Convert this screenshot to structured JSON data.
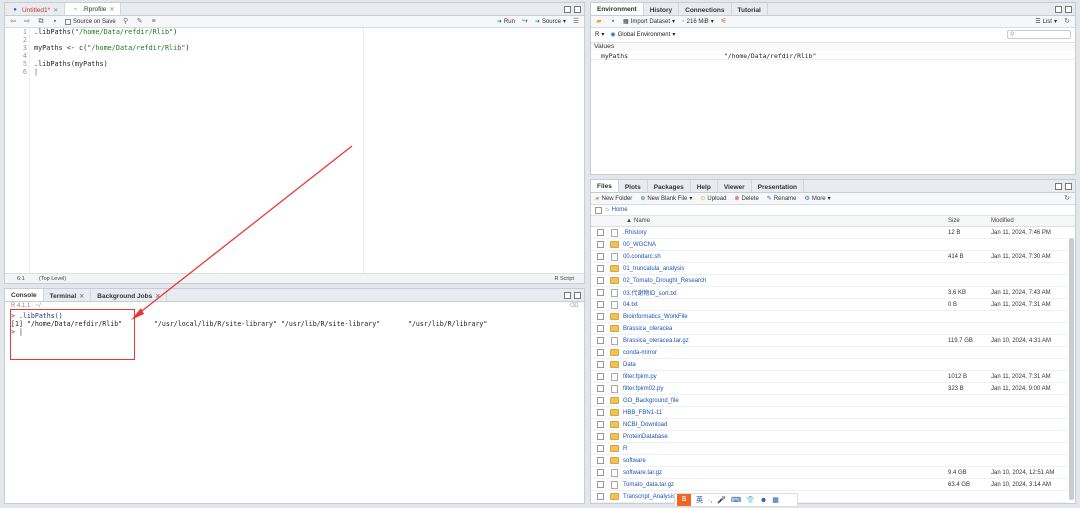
{
  "source_pane": {
    "tabs": [
      {
        "label": "Untitled1*"
      },
      {
        "label": ".Rprofile"
      }
    ],
    "toolbar": {
      "source_on_save": "Source on Save",
      "run": "Run",
      "source": "Source"
    },
    "lines": [
      {
        "n": "1",
        "prefix": ".libPaths(",
        "str": "\"/home/Data/refdir/Rlib\"",
        "suffix": ")"
      },
      {
        "n": "2",
        "prefix": "",
        "str": "",
        "suffix": ""
      },
      {
        "n": "3",
        "prefix": "myPaths <- c(",
        "str": "\"/home/Data/refdir/Rlib\"",
        "suffix": ")"
      },
      {
        "n": "4",
        "prefix": "",
        "str": "",
        "suffix": ""
      },
      {
        "n": "5",
        "prefix": ".libPaths(myPaths)",
        "str": "",
        "suffix": ""
      },
      {
        "n": "6",
        "prefix": "",
        "str": "",
        "suffix": ""
      }
    ],
    "status": {
      "position": "6:1",
      "scope": "(Top Level)",
      "type": "R Script"
    }
  },
  "console_pane": {
    "tabs": [
      {
        "label": "Console"
      },
      {
        "label": "Terminal"
      },
      {
        "label": "Background Jobs"
      }
    ],
    "header": "R 4.1.1 · ~/",
    "command": ".libPaths()",
    "output": "[1] \"/home/Data/refdir/Rlib\"        \"/usr/local/lib/R/site-library\" \"/usr/lib/R/site-library\"       \"/usr/lib/R/library\"",
    "prompt": ">"
  },
  "env_pane": {
    "tabs": [
      {
        "label": "Environment"
      },
      {
        "label": "History"
      },
      {
        "label": "Connections"
      },
      {
        "label": "Tutorial"
      }
    ],
    "import_dataset": "Import Dataset",
    "memory": "216 MiB",
    "list_view": "List",
    "language": "R",
    "scope": "Global Environment",
    "section": "Values",
    "values": [
      {
        "name": "myPaths",
        "value": "\"/home/Data/refdir/Rlib\""
      }
    ]
  },
  "files_pane": {
    "tabs": [
      {
        "label": "Files"
      },
      {
        "label": "Plots"
      },
      {
        "label": "Packages"
      },
      {
        "label": "Help"
      },
      {
        "label": "Viewer"
      },
      {
        "label": "Presentation"
      }
    ],
    "toolbar": {
      "new_folder": "New Folder",
      "new_blank_file": "New Blank File",
      "upload": "Upload",
      "delete": "Delete",
      "rename": "Rename",
      "more": "More"
    },
    "breadcrumb": "Home",
    "columns": {
      "name": "Name",
      "size": "Size",
      "modified": "Modified"
    },
    "files": [
      {
        "name": ".Rhistory",
        "size": "12 B",
        "modified": "Jan 11, 2024, 7:46 PM",
        "kind": "file"
      },
      {
        "name": "00_WGCNA",
        "size": "",
        "modified": "",
        "kind": "folder"
      },
      {
        "name": "00.condarc.sh",
        "size": "414 B",
        "modified": "Jan 11, 2024, 7:30 AM",
        "kind": "file"
      },
      {
        "name": "01_truncatula_analysis",
        "size": "",
        "modified": "",
        "kind": "folder"
      },
      {
        "name": "02_Tomato_Drought_Research",
        "size": "",
        "modified": "",
        "kind": "folder"
      },
      {
        "name": "03.代谢物ID_sort.txt",
        "size": "3.6 KB",
        "modified": "Jan 11, 2024, 7:43 AM",
        "kind": "file"
      },
      {
        "name": "04.txt",
        "size": "0 B",
        "modified": "Jan 11, 2024, 7:31 AM",
        "kind": "file"
      },
      {
        "name": "Bioinformatics_WorkFile",
        "size": "",
        "modified": "",
        "kind": "folder"
      },
      {
        "name": "Brassica_oleracea",
        "size": "",
        "modified": "",
        "kind": "folder"
      },
      {
        "name": "Brassica_oleracea.tar.gz",
        "size": "119.7 GB",
        "modified": "Jan 10, 2024, 4:31 AM",
        "kind": "file"
      },
      {
        "name": "conda-mirror",
        "size": "",
        "modified": "",
        "kind": "folder"
      },
      {
        "name": "Data",
        "size": "",
        "modified": "",
        "kind": "folder"
      },
      {
        "name": "filter.fpkm.py",
        "size": "1012 B",
        "modified": "Jan 11, 2024, 7:31 AM",
        "kind": "file"
      },
      {
        "name": "filter.fpkm02.py",
        "size": "323 B",
        "modified": "Jan 11, 2024, 9:00 AM",
        "kind": "file"
      },
      {
        "name": "GO_Background_file",
        "size": "",
        "modified": "",
        "kind": "folder"
      },
      {
        "name": "HBB_FBN1-11",
        "size": "",
        "modified": "",
        "kind": "folder"
      },
      {
        "name": "NCBI_Download",
        "size": "",
        "modified": "",
        "kind": "folder"
      },
      {
        "name": "ProteinDatabase",
        "size": "",
        "modified": "",
        "kind": "folder"
      },
      {
        "name": "R",
        "size": "",
        "modified": "",
        "kind": "folder"
      },
      {
        "name": "software",
        "size": "",
        "modified": "",
        "kind": "folder"
      },
      {
        "name": "software.tar.gz",
        "size": "9.4 GB",
        "modified": "Jan 10, 2024, 12:51 AM",
        "kind": "file"
      },
      {
        "name": "Tomato_data.tar.gz",
        "size": "63.4 GB",
        "modified": "Jan 10, 2024, 3:14 AM",
        "kind": "file"
      },
      {
        "name": "Transcript_Analysis",
        "size": "",
        "modified": "",
        "kind": "folder"
      }
    ]
  },
  "ime_bar": {
    "lang": "英"
  },
  "colors": {
    "annotation_red": "#e53935",
    "string_green": "#1b7a1b",
    "link_blue": "#1a56b0"
  }
}
